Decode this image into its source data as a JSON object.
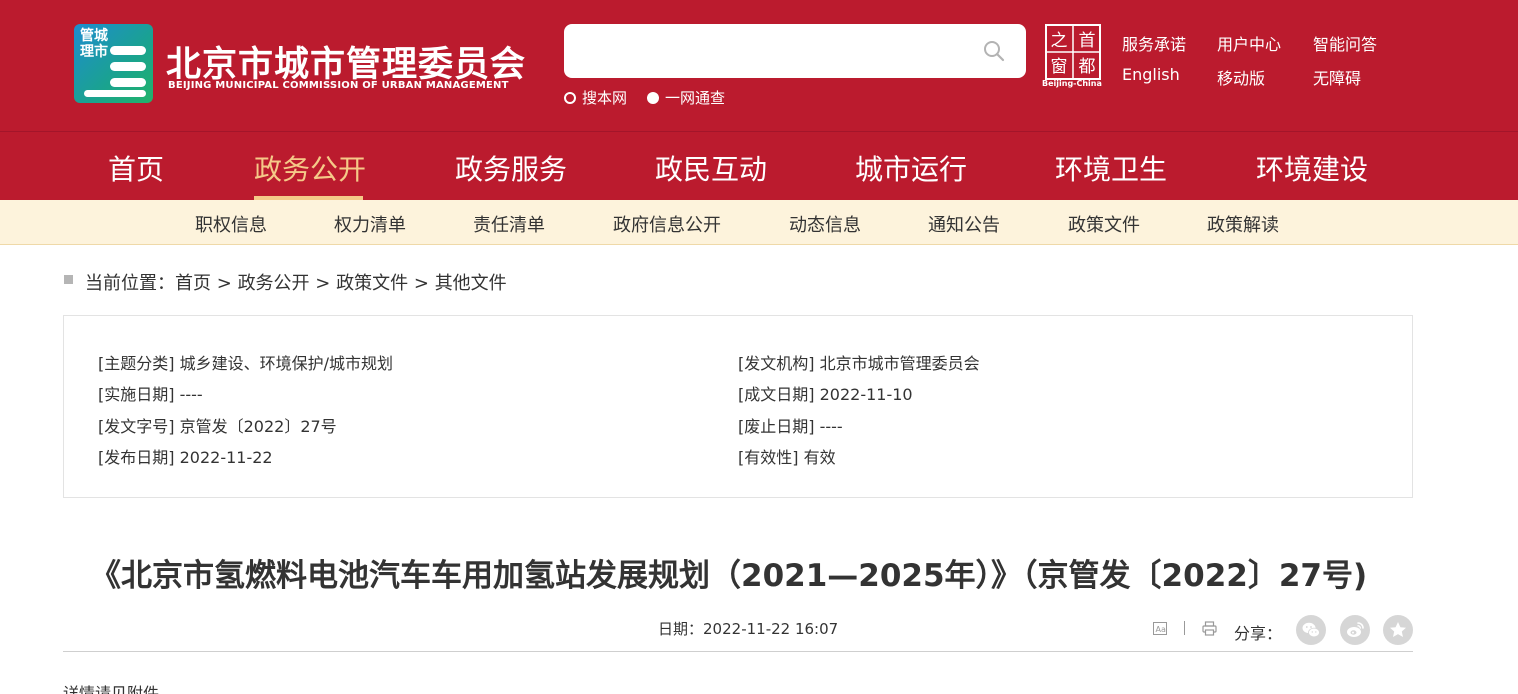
{
  "header": {
    "logo": {
      "text": "管城理市",
      "icon": "city-management-logo"
    },
    "org_name_cn": "北京市城市管理委员会",
    "org_name_en": "BEIJING MUNICIPAL COMMISSION OF URBAN MANAGEMENT",
    "search": {
      "value": "",
      "placeholder": "",
      "icon": "search-icon"
    },
    "search_scopes": [
      {
        "label": "搜本网",
        "selected": false
      },
      {
        "label": "一网通查",
        "selected": true
      }
    ],
    "capital_logo": {
      "chars": [
        "之",
        "首",
        "窗",
        "都"
      ],
      "subtitle": "Beijing-China"
    },
    "top_links": [
      "服务承诺",
      "用户中心",
      "智能问答",
      "English",
      "移动版",
      "无障碍"
    ]
  },
  "main_nav": {
    "items": [
      "首页",
      "政务公开",
      "政务服务",
      "政民互动",
      "城市运行",
      "环境卫生",
      "环境建设"
    ],
    "active_index": 1,
    "active_color": "#f5c988",
    "bg_color": "#bb1b2e"
  },
  "sub_nav": {
    "items": [
      "职权信息",
      "权力清单",
      "责任清单",
      "政府信息公开",
      "动态信息",
      "通知公告",
      "政策文件",
      "政策解读"
    ]
  },
  "breadcrumb": {
    "prefix": "当前位置：",
    "items": [
      "首页",
      "政务公开",
      "政策文件",
      "其他文件"
    ],
    "separator": ">"
  },
  "meta": [
    {
      "label": "[主题分类]",
      "value": "城乡建设、环境保护/城市规划"
    },
    {
      "label": "[发文机构]",
      "value": "北京市城市管理委员会"
    },
    {
      "label": "[实施日期]",
      "value": "----"
    },
    {
      "label": "[成文日期]",
      "value": "2022-11-10"
    },
    {
      "label": "[发文字号]",
      "value": "京管发〔2022〕27号"
    },
    {
      "label": "[废止日期]",
      "value": "----"
    },
    {
      "label": "[发布日期]",
      "value": "2022-11-22"
    },
    {
      "label": "[有效性]",
      "value": "有效"
    }
  ],
  "article": {
    "title": "《北京市氢燃料电池汽车车用加氢站发展规划（2021—2025年）》（京管发〔2022〕27号)",
    "date_label": "日期：",
    "date_value": "2022-11-22 16:07",
    "share_label": "分享：",
    "share_icons": [
      "wechat-icon",
      "weibo-icon",
      "favorite-star-icon"
    ],
    "tool_icons": [
      "font-size-icon",
      "print-icon"
    ],
    "body_first_line": "详情请见附件"
  }
}
